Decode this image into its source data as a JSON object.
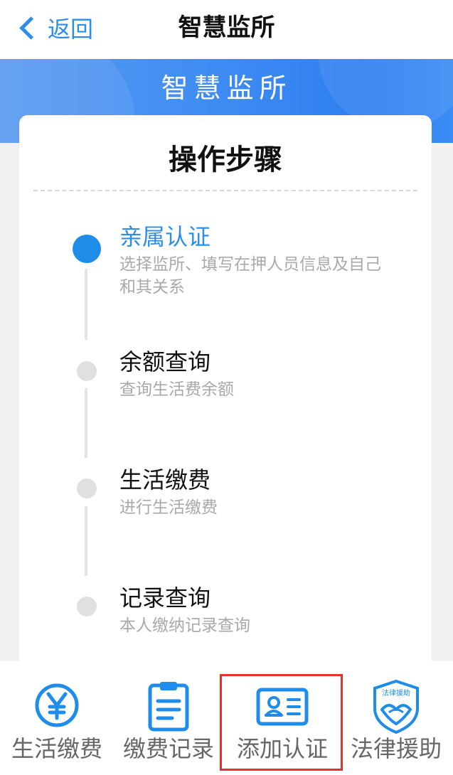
{
  "nav": {
    "back_label": "返回",
    "title": "智慧监所"
  },
  "banner": {
    "title": "智慧监所"
  },
  "card": {
    "title": "操作步骤",
    "steps": [
      {
        "title": "亲属认证",
        "desc": "选择监所、填写在押人员信息及自己和其关系",
        "active": true
      },
      {
        "title": "余额查询",
        "desc": "查询生活费余额",
        "active": false
      },
      {
        "title": "生活缴费",
        "desc": "进行生活缴费",
        "active": false
      },
      {
        "title": "记录查询",
        "desc": "本人缴纳记录查询",
        "active": false
      }
    ]
  },
  "tabbar": {
    "items": [
      {
        "label": "生活缴费",
        "icon": "yen-coin-icon"
      },
      {
        "label": "缴费记录",
        "icon": "clipboard-list-icon"
      },
      {
        "label": "添加认证",
        "icon": "id-card-icon"
      },
      {
        "label": "法律援助",
        "icon": "legal-aid-shield-icon",
        "icon_text": "法律援助"
      }
    ]
  },
  "colors": {
    "accent": "#2d8ee8",
    "highlight": "#e8302a",
    "inactive_dot": "#e0e0e0"
  }
}
